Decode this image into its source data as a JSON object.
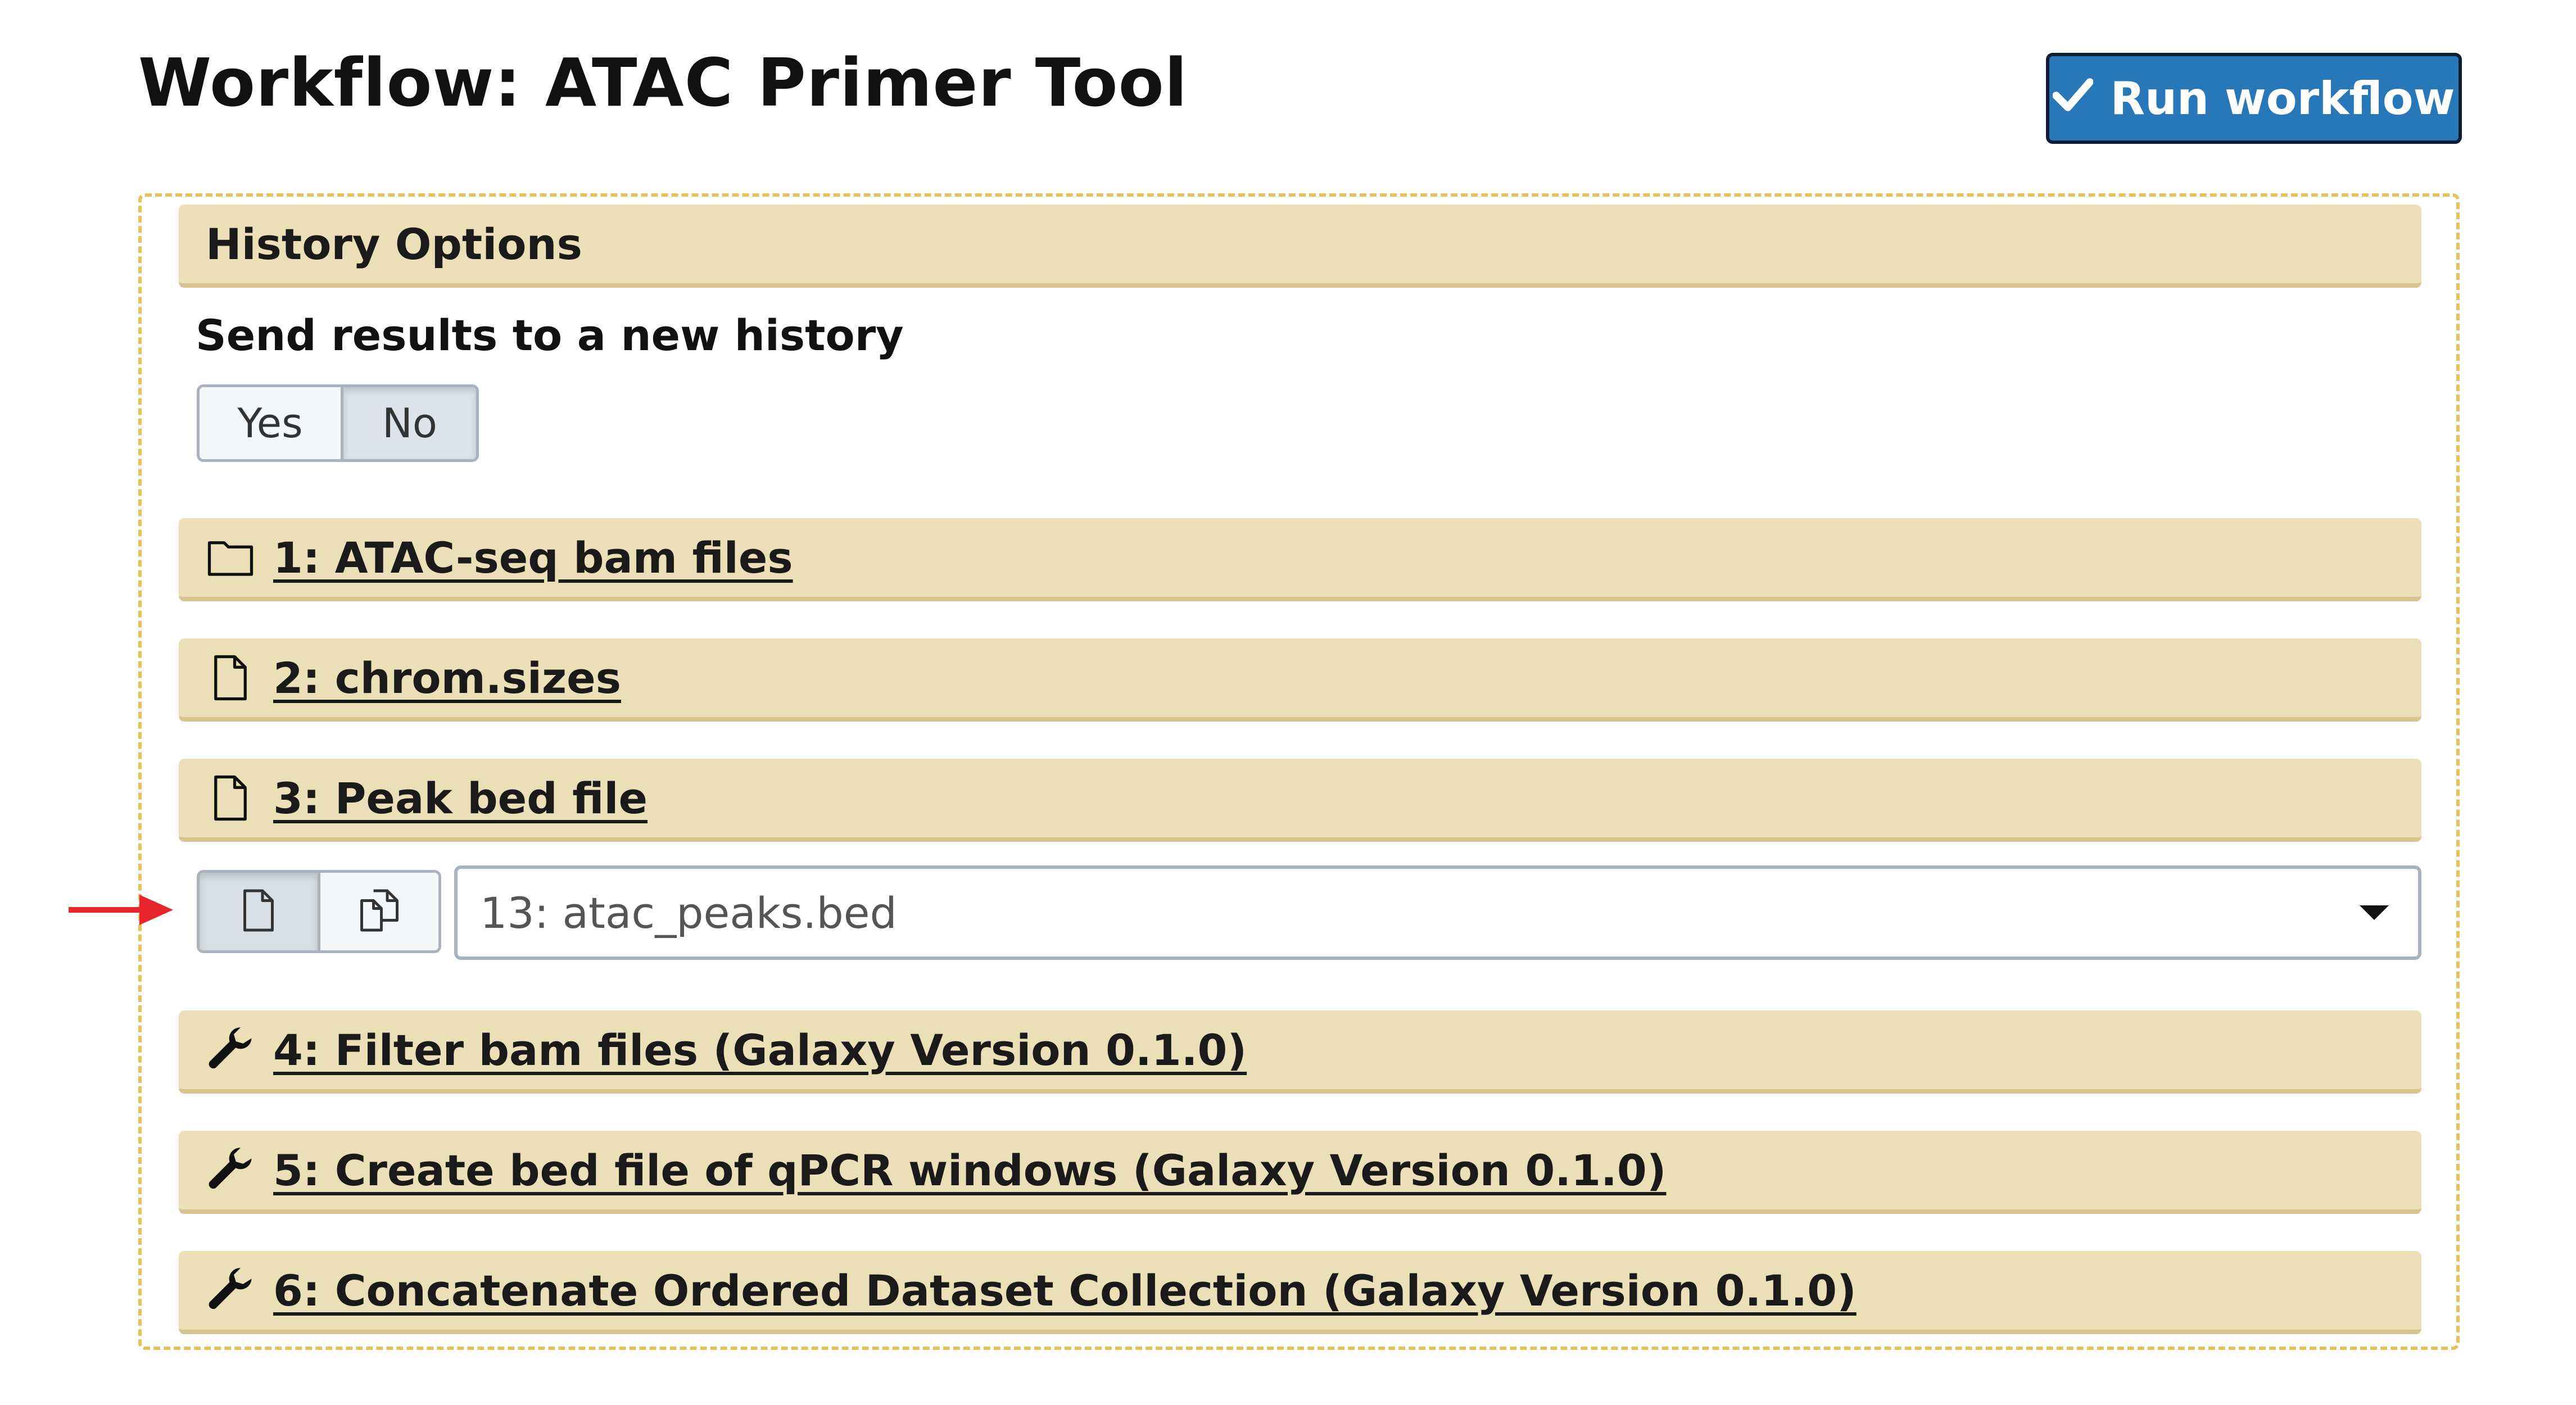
{
  "page": {
    "title": "Workflow: ATAC Primer Tool",
    "run_label": "Run workflow"
  },
  "history": {
    "header": "History Options",
    "option_label": "Send results to a new history",
    "toggle": {
      "yes": "Yes",
      "no": "No",
      "selected": "No"
    }
  },
  "steps": [
    {
      "label": "1: ATAC-seq bam files",
      "icon": "folder-icon"
    },
    {
      "label": "2: chrom.sizes",
      "icon": "file-icon"
    },
    {
      "label": "3: Peak bed file",
      "icon": "file-icon"
    },
    {
      "label": "4: Filter bam files (Galaxy Version 0.1.0)",
      "icon": "wrench-icon"
    },
    {
      "label": "5: Create bed file of qPCR windows (Galaxy Version 0.1.0)",
      "icon": "wrench-icon"
    },
    {
      "label": "6: Concatenate Ordered Dataset Collection (Galaxy Version 0.1.0)",
      "icon": "wrench-icon"
    }
  ],
  "peak_input": {
    "value": "13: atac_peaks.bed",
    "source_buttons": [
      "single-dataset-icon",
      "multiple-datasets-icon"
    ]
  },
  "colors": {
    "accent": "#2877b8",
    "header_bg": "#ebdfb7",
    "box_border": "#e3c35a",
    "arrow": "#e8262b"
  }
}
